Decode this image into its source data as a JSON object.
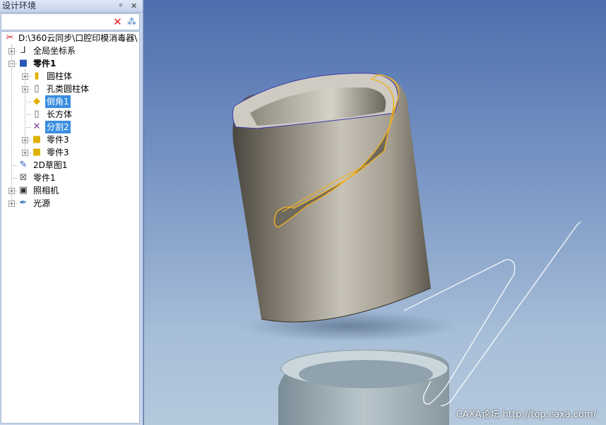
{
  "panel": {
    "title": "设计环境",
    "pin_glyph": "ᵖ",
    "close_glyph": "✕"
  },
  "toolbar": {
    "delete_glyph": "✕",
    "filter_glyph": "⁂"
  },
  "tree": {
    "root": "D:\\360云同步\\口腔印模消毒器\\",
    "items": [
      {
        "label": "全局坐标系"
      },
      {
        "label": "零件1"
      },
      {
        "label": "圆柱体"
      },
      {
        "label": "孔类圆柱体"
      },
      {
        "label": "倒角1"
      },
      {
        "label": "长方体"
      },
      {
        "label": "分割2"
      },
      {
        "label": "零件3"
      },
      {
        "label": "零件3"
      },
      {
        "label": "2D草图1"
      },
      {
        "label": "零件1"
      },
      {
        "label": "照相机"
      },
      {
        "label": "光源"
      }
    ]
  },
  "viewport": {
    "watermark": "CAXA论坛 http://top.caxa.com/"
  },
  "colors": {
    "viewport_top": "#4d6eae",
    "viewport_bottom": "#b5c9dd",
    "selection": "#3a8de0",
    "highlight_edge": "#f0b020"
  }
}
